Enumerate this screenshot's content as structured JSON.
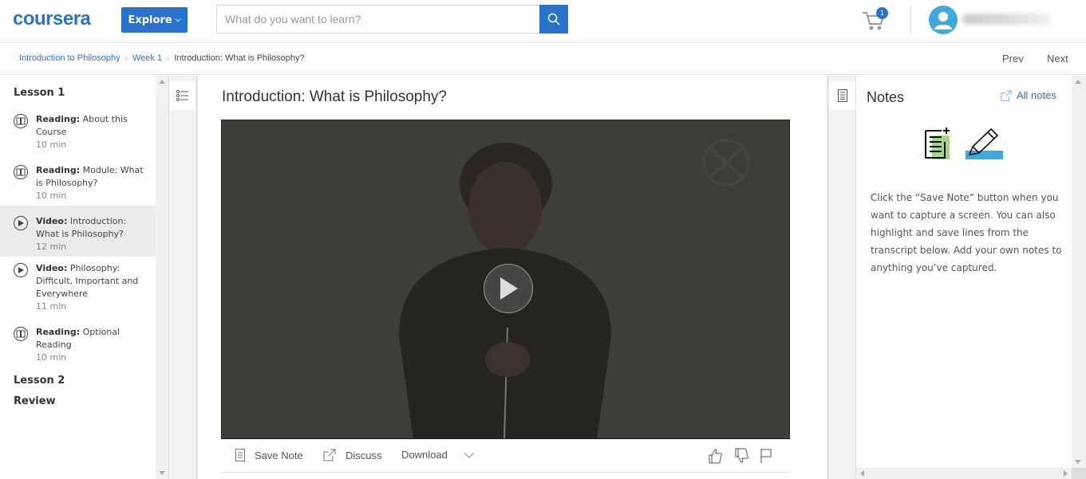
{
  "header": {
    "logo": "coursera",
    "explore_label": "Explore",
    "search_placeholder": "What do you want to learn?",
    "cart_count": "1",
    "brand_color": "#2a73cc"
  },
  "breadcrumb": {
    "items": [
      "Introduction to Philosophy",
      "Week 1",
      "Introduction: What is Philosophy?"
    ],
    "prev_label": "Prev",
    "next_label": "Next"
  },
  "sidebar": {
    "lessons": [
      {
        "title": "Lesson 1"
      },
      {
        "title": "Lesson 2"
      },
      {
        "title": "Review"
      }
    ],
    "items": [
      {
        "type": "Reading:",
        "title": "About this Course",
        "duration": "10 min",
        "icon": "book-icon"
      },
      {
        "type": "Reading:",
        "title": "Module: What is Philosophy?",
        "duration": "10 min",
        "icon": "book-icon"
      },
      {
        "type": "Video:",
        "title": "Introduction: What is Philosophy?",
        "duration": "12 min",
        "icon": "play-circle-icon",
        "active": true
      },
      {
        "type": "Video:",
        "title": "Philosophy: Difficult, Important and Everywhere",
        "duration": "11 min",
        "icon": "play-circle-icon"
      },
      {
        "type": "Reading:",
        "title": "Optional Reading",
        "duration": "10 min",
        "icon": "book-icon"
      }
    ]
  },
  "main": {
    "title": "Introduction: What is Philosophy?",
    "toolbar": {
      "save_note": "Save Note",
      "discuss": "Discuss",
      "download": "Download"
    }
  },
  "notes": {
    "title": "Notes",
    "all_notes": "All notes",
    "help_text": "Click the “Save Note” button when you want to capture a screen. You can also highlight and save lines from the transcript below. Add your own notes to anything you’ve captured."
  }
}
